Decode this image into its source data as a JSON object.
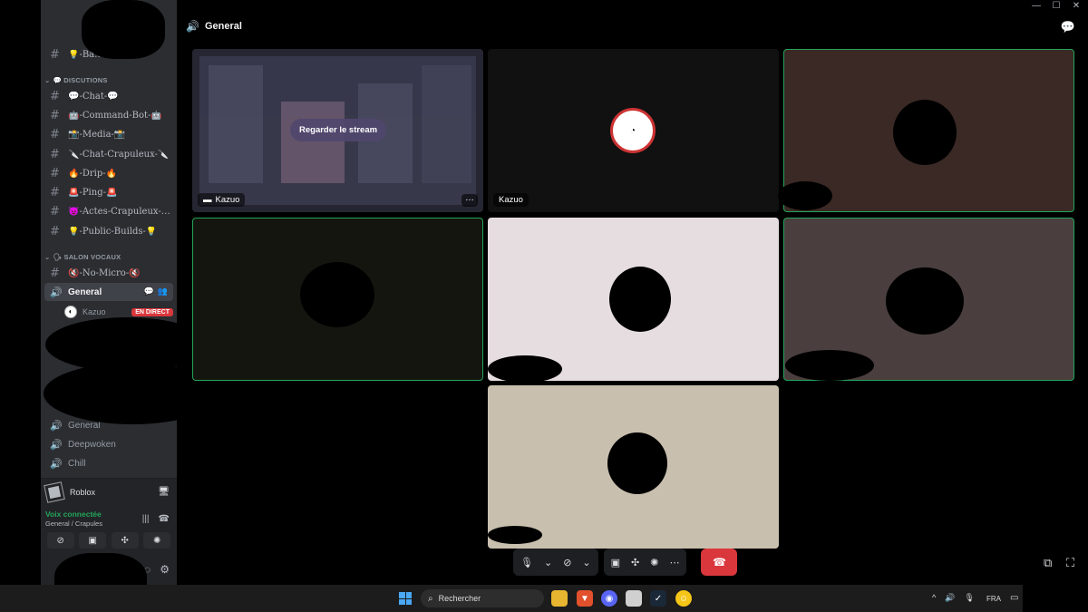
{
  "window": {
    "minimize": "—",
    "maximize": "☐",
    "close": "✕"
  },
  "sidebar": {
    "partial_channel": "💡-Ba…",
    "category_text": "💬 DISCUTIONS",
    "text_channels": [
      {
        "label": "💬-Chat-💬"
      },
      {
        "label": "🤖-Command-Bot-🤖"
      },
      {
        "label": "📸-Media-📸"
      },
      {
        "label": "🔪-Chat-Crapuleux-🔪"
      },
      {
        "label": "🔥-Drip-🔥"
      },
      {
        "label": "🚨-Ping-🚨"
      },
      {
        "label": "👿-Actes-Crapuleux-…"
      },
      {
        "label": "💡-Public-Builds-💡"
      }
    ],
    "voice_category": "🗣 SALON VOCAUX",
    "voice_channels": [
      {
        "label": "🔇-No-Micro-🔇"
      },
      {
        "label": "General"
      }
    ],
    "member": {
      "name": "Kazuo",
      "badge": "EN DIRECT"
    },
    "more_voice": [
      {
        "label": "General"
      },
      {
        "label": "Deepwoken"
      },
      {
        "label": "Chill"
      }
    ],
    "activity": {
      "game": "Roblox"
    },
    "voice_status": {
      "connected": "Voix connectée",
      "location": "General / Crapules"
    }
  },
  "header": {
    "title": "General"
  },
  "tiles": {
    "stream": {
      "button": "Regarder le stream",
      "label": "Kazuo"
    },
    "avatar": {
      "label": "Kazuo"
    }
  },
  "taskbar": {
    "search": "Rechercher",
    "lang": "FRA"
  },
  "colors": {
    "accent_green": "#23a55a",
    "danger": "#da373c",
    "sidebar_bg": "#2b2d31"
  }
}
